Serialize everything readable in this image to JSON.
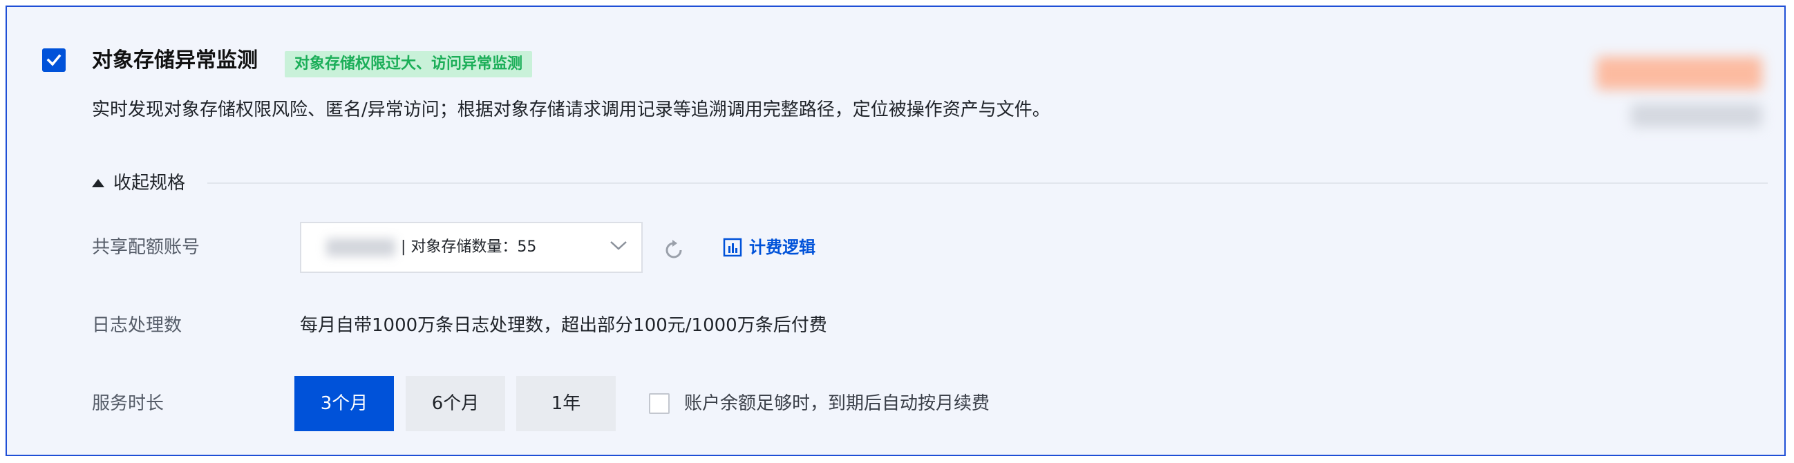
{
  "product": {
    "checked": true,
    "title": "对象存储异常监测",
    "tag": "对象存储权限过大、访问异常监测",
    "description": "实时发现对象存储权限风险、匿名/异常访问；根据对象存储请求调用记录等追溯调用完整路径，定位被操作资产与文件。"
  },
  "spec": {
    "collapse_label": "收起规格",
    "shared_quota": {
      "label": "共享配额账号",
      "selected_suffix": "| 对象存储数量：55"
    },
    "billing_link": "计费逻辑",
    "log_processing": {
      "label": "日志处理数",
      "value": "每月自带1000万条日志处理数，超出部分100元/1000万条后付费"
    },
    "duration": {
      "label": "服务时长",
      "options": [
        "3个月",
        "6个月",
        "1年"
      ],
      "selected": "3个月"
    },
    "auto_renew": {
      "checked": false,
      "label": "账户余额足够时，到期后自动按月续费"
    }
  },
  "colors": {
    "accent": "#0052d9",
    "tag_bg": "#c9f1d9",
    "tag_text": "#1bae58",
    "card_bg": "#f2f5fc",
    "card_border": "#1f4fd6"
  },
  "icons": [
    "check-icon",
    "triangle-up-icon",
    "chevron-down-icon",
    "refresh-icon",
    "chart-icon"
  ]
}
